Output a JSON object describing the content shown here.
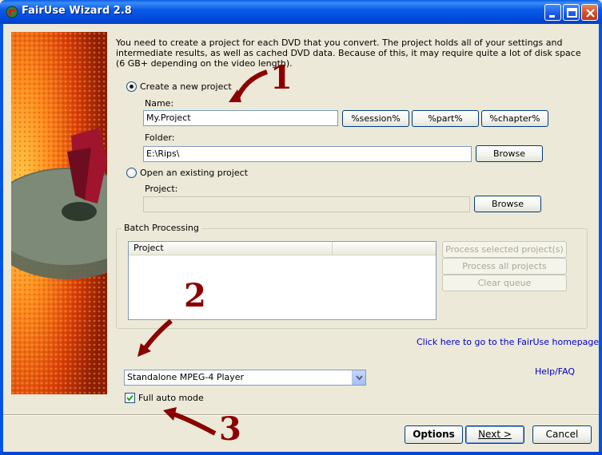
{
  "window": {
    "title": "FairUse Wizard 2.8",
    "title_bar_color": "#0054e3"
  },
  "intro_text": "You need to create a project for each DVD that you convert. The project holds all of your settings and intermediate results, as well as cached DVD data. Because of this, it may require quite a lot of disk space (6 GB+ depending on the video length).",
  "new_project": {
    "radio_label": "Create a new project",
    "selected": true,
    "name_label": "Name:",
    "name_value": "My.Project",
    "session_button": "%session%",
    "part_button": "%part%",
    "chapter_button": "%chapter%",
    "folder_label": "Folder:",
    "folder_value": "E:\\Rips\\",
    "browse_button": "Browse"
  },
  "existing_project": {
    "radio_label": "Open an existing project",
    "selected": false,
    "project_label": "Project:",
    "project_value": "",
    "browse_button": "Browse"
  },
  "batch": {
    "title": "Batch Processing",
    "column_header": "Project",
    "process_selected": "Process selected project(s)",
    "process_all": "Process all projects",
    "clear_queue": "Clear queue"
  },
  "homepage_link": "Click here to go to the FairUse homepage",
  "help_link": "Help/FAQ",
  "player_profile": {
    "selected": "Standalone MPEG-4 Player"
  },
  "full_auto": {
    "label": "Full auto mode",
    "checked": true
  },
  "footer": {
    "options_button": "Options",
    "next_button": "Next >",
    "cancel_button": "Cancel"
  },
  "annotations": [
    "1",
    "2",
    "3"
  ],
  "annotation_color": "#8b0000",
  "link_color": "#0000cc"
}
